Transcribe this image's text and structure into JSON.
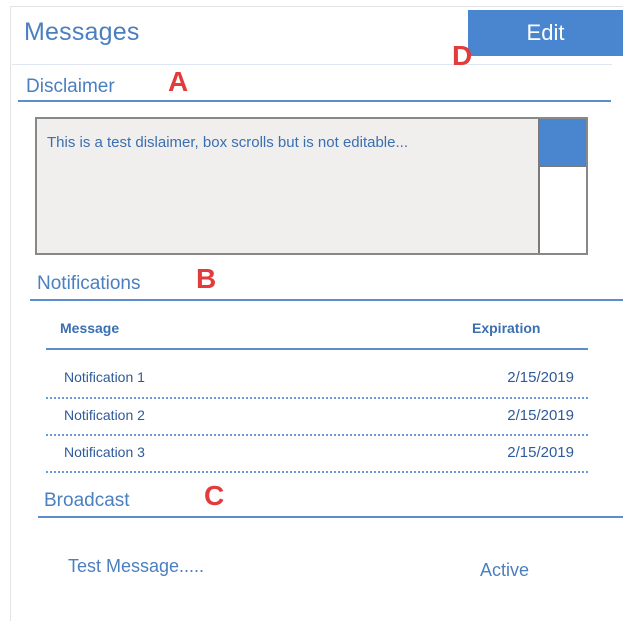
{
  "header": {
    "title": "Messages",
    "edit_label": "Edit"
  },
  "markers": {
    "a": "A",
    "b": "B",
    "c": "C",
    "d": "D"
  },
  "disclaimer": {
    "label": "Disclaimer",
    "text": "This is a test dislaimer, box scrolls but is not editable..."
  },
  "notifications": {
    "label": "Notifications",
    "columns": {
      "message": "Message",
      "expiration": "Expiration"
    },
    "rows": [
      {
        "message": "Notification 1",
        "expiration": "2/15/2019"
      },
      {
        "message": "Notification 2",
        "expiration": "2/15/2019"
      },
      {
        "message": "Notification 3",
        "expiration": "2/15/2019"
      }
    ]
  },
  "broadcast": {
    "label": "Broadcast",
    "message": "Test Message.....",
    "status": "Active"
  },
  "colors": {
    "accent": "#4a86cf",
    "text": "#4a7fc0",
    "marker": "#e23b3b"
  }
}
